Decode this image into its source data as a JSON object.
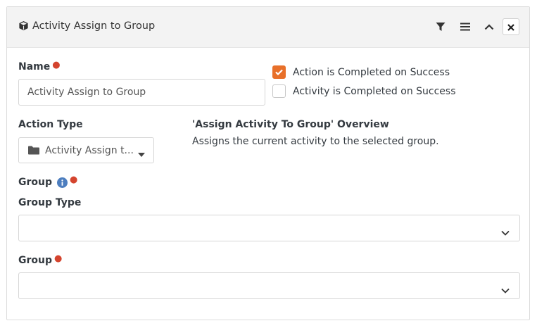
{
  "panel": {
    "title": "Activity Assign to Group",
    "header_icons": [
      "filter-icon",
      "menu-icon",
      "chevron-up-icon",
      "close-icon"
    ]
  },
  "form": {
    "name_label": "Name",
    "name_value": "Activity Assign to Group",
    "action_completed_label": "Action is Completed on Success",
    "action_completed_checked": true,
    "activity_completed_label": "Activity is Completed on Success",
    "activity_completed_checked": false,
    "action_type_label": "Action Type",
    "action_type_value": "Activity Assign t...",
    "overview_title": "'Assign Activity To Group' Overview",
    "overview_desc": "Assigns the current activity to the selected group.",
    "group_label": "Group",
    "group_type_label": "Group Type",
    "group_type_value": "",
    "group_select_label": "Group",
    "group_select_value": ""
  },
  "colors": {
    "accent": "#e8702a",
    "required": "#d4442e",
    "info": "#4d7ebf",
    "header_bg": "#f3f3f3"
  }
}
